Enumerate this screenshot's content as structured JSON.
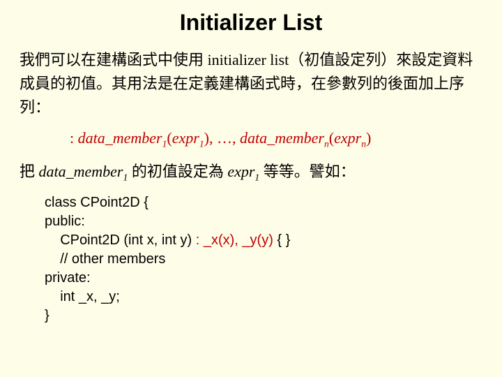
{
  "title": "Initializer List",
  "para1": "我們可以在建構函式中使用 initializer list（初值設定列）來設定資料成員的初值。其用法是在定義建構函式時，在參數列的後面加上序列：",
  "syntax": {
    "lead": ": ",
    "dm": "data_member",
    "lp": "(",
    "ex": "expr",
    "rp": ")",
    "sep": ", …, ",
    "s1": "1",
    "sn": "n"
  },
  "para2": {
    "t1": "把 ",
    "dm": "data_member",
    "s1": "1",
    "t2": " 的初值設定為 ",
    "ex": "expr",
    "t3": " 等等。譬如："
  },
  "code": {
    "l1": "class CPoint2D {",
    "l2": "public:",
    "l3a": "    CPoint2D (int x, int y) ",
    "l3b": ": _x(x), _y(y)",
    "l3c": " { }",
    "l4": "    // other members",
    "l5": "private:",
    "l6": "    int _x, _y;",
    "l7": "}"
  }
}
